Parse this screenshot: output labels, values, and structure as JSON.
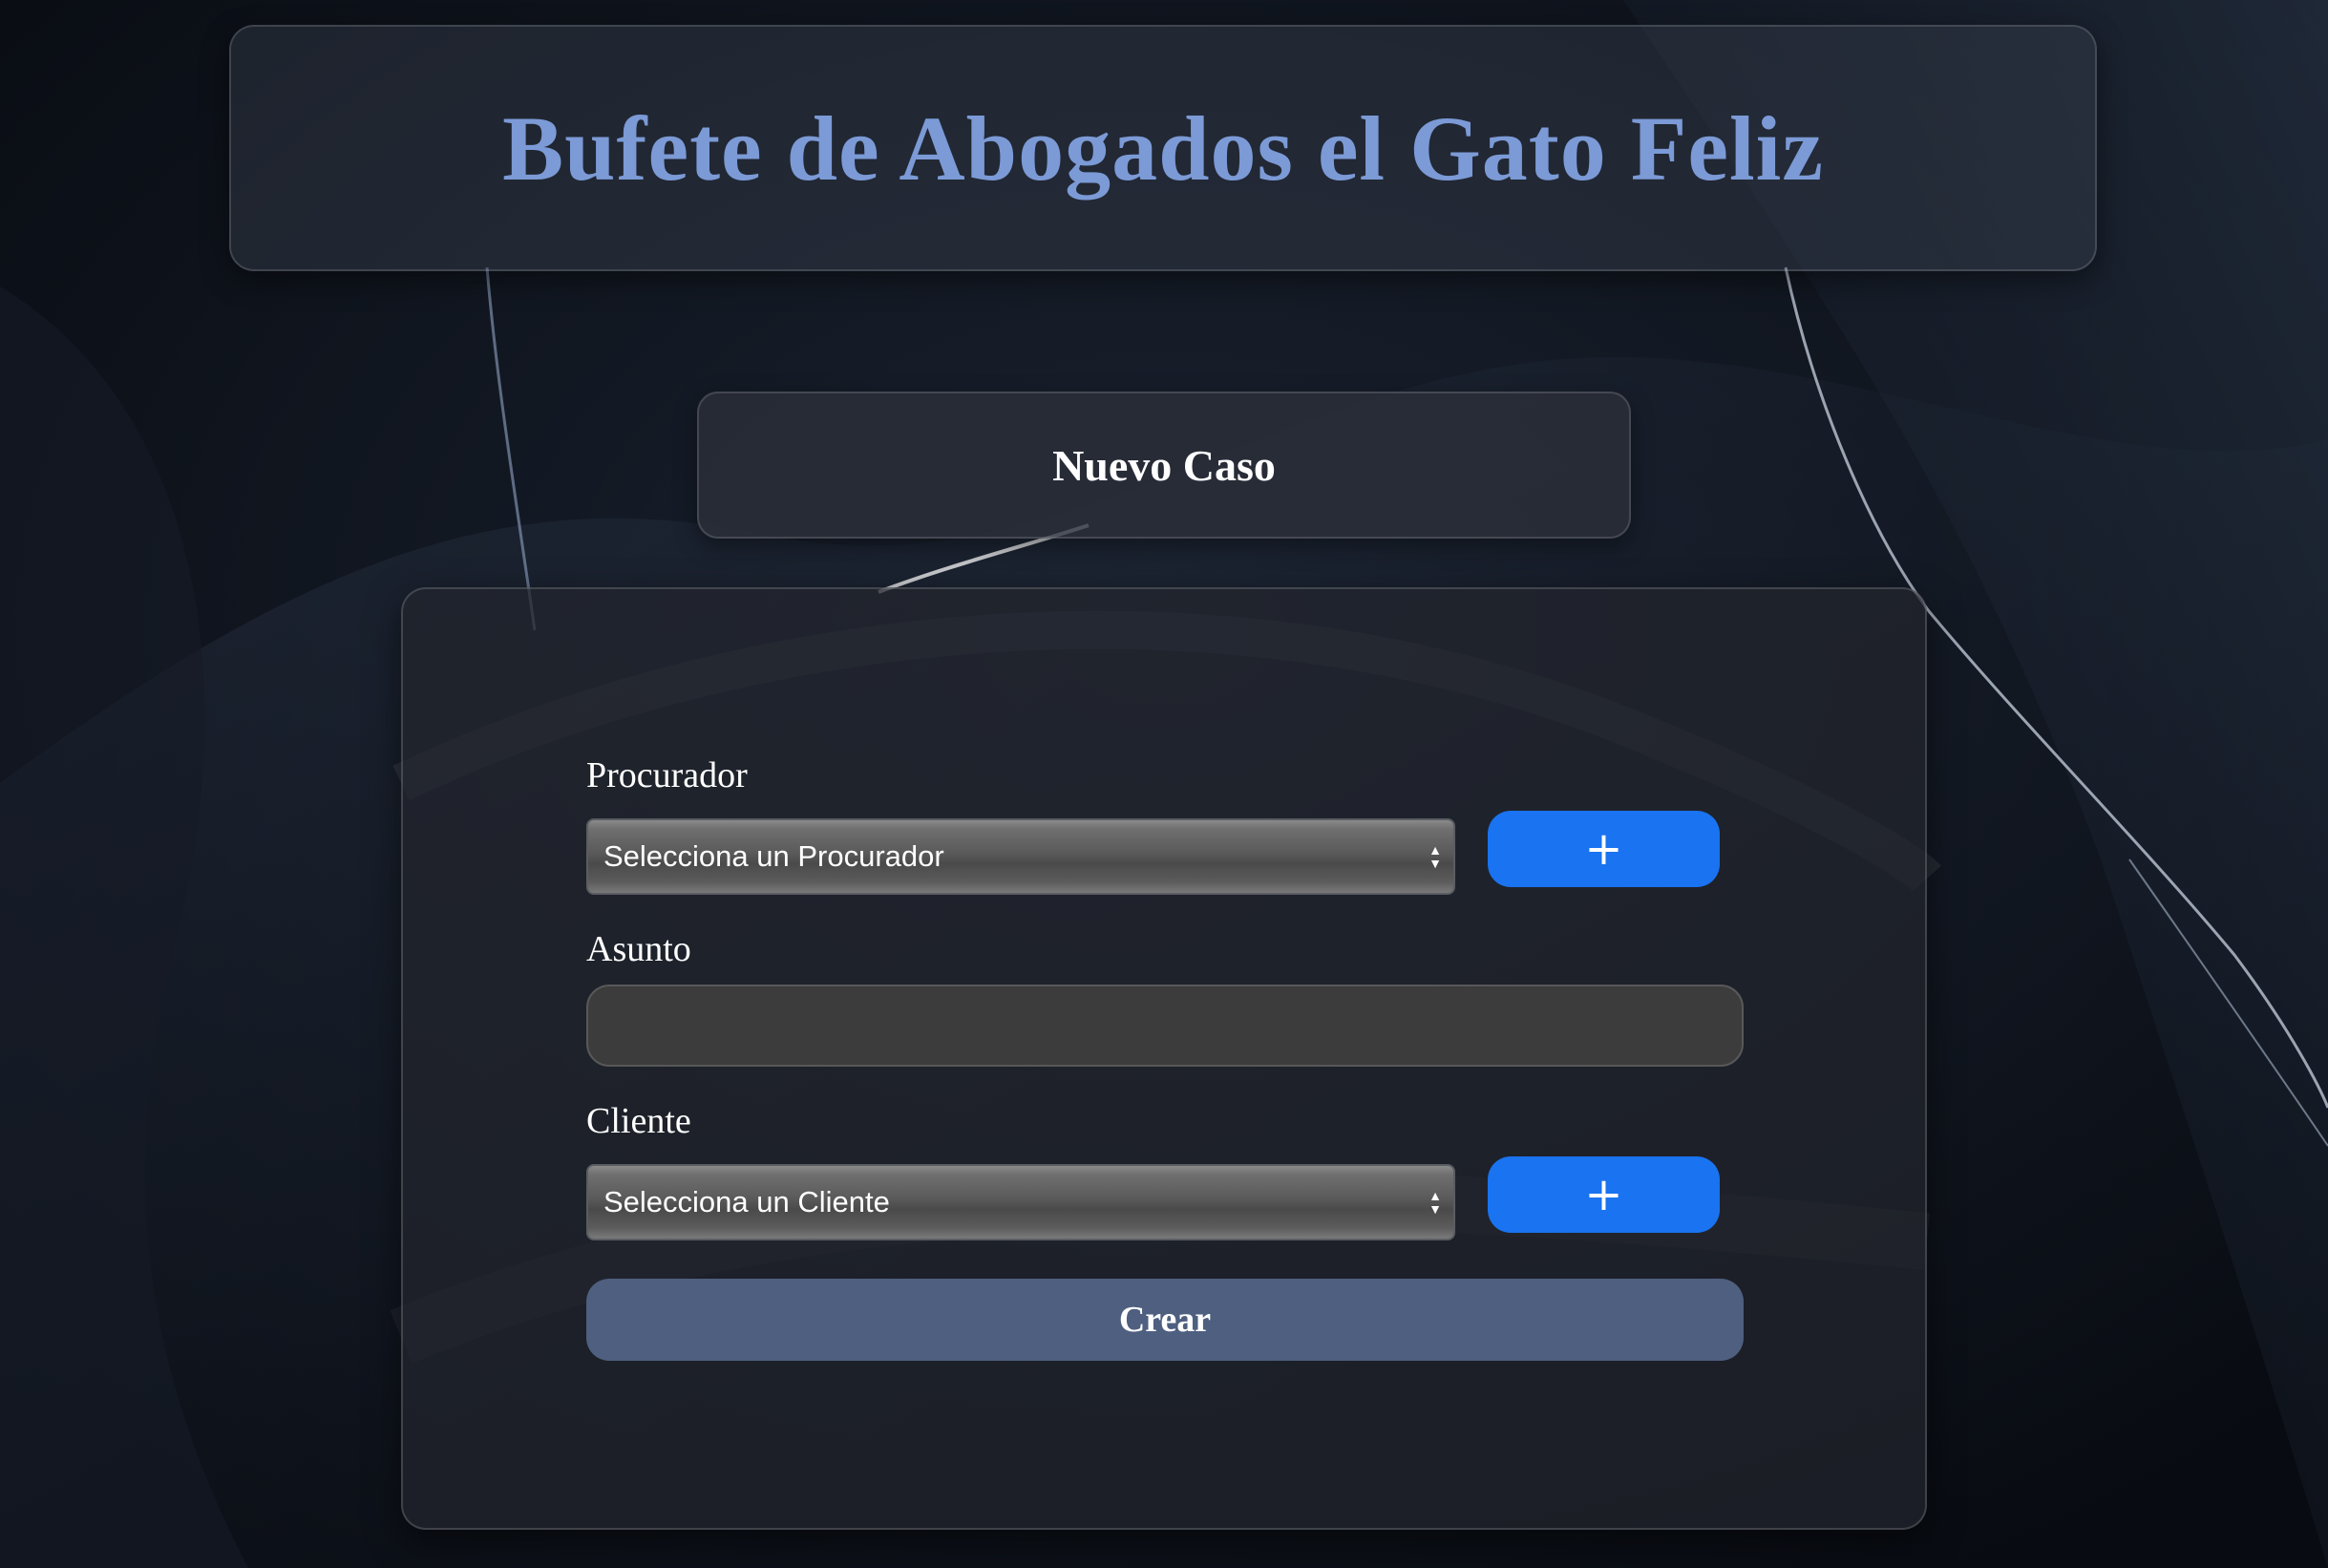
{
  "header": {
    "title": "Bufete de Abogados el Gato Feliz"
  },
  "page": {
    "subtitle": "Nuevo Caso"
  },
  "form": {
    "procurador": {
      "label": "Procurador",
      "selected": "Selecciona un Procurador",
      "add_label": "+"
    },
    "asunto": {
      "label": "Asunto",
      "value": ""
    },
    "cliente": {
      "label": "Cliente",
      "selected": "Selecciona un Cliente",
      "add_label": "+"
    },
    "submit_label": "Crear"
  },
  "colors": {
    "title": "#7b9ad6",
    "add_button": "#1a73f0",
    "submit_button": "#4e5f80",
    "background": "#0b0f17"
  },
  "icons": {
    "add": "plus-icon",
    "select_arrows": "up-down-arrows-icon"
  }
}
